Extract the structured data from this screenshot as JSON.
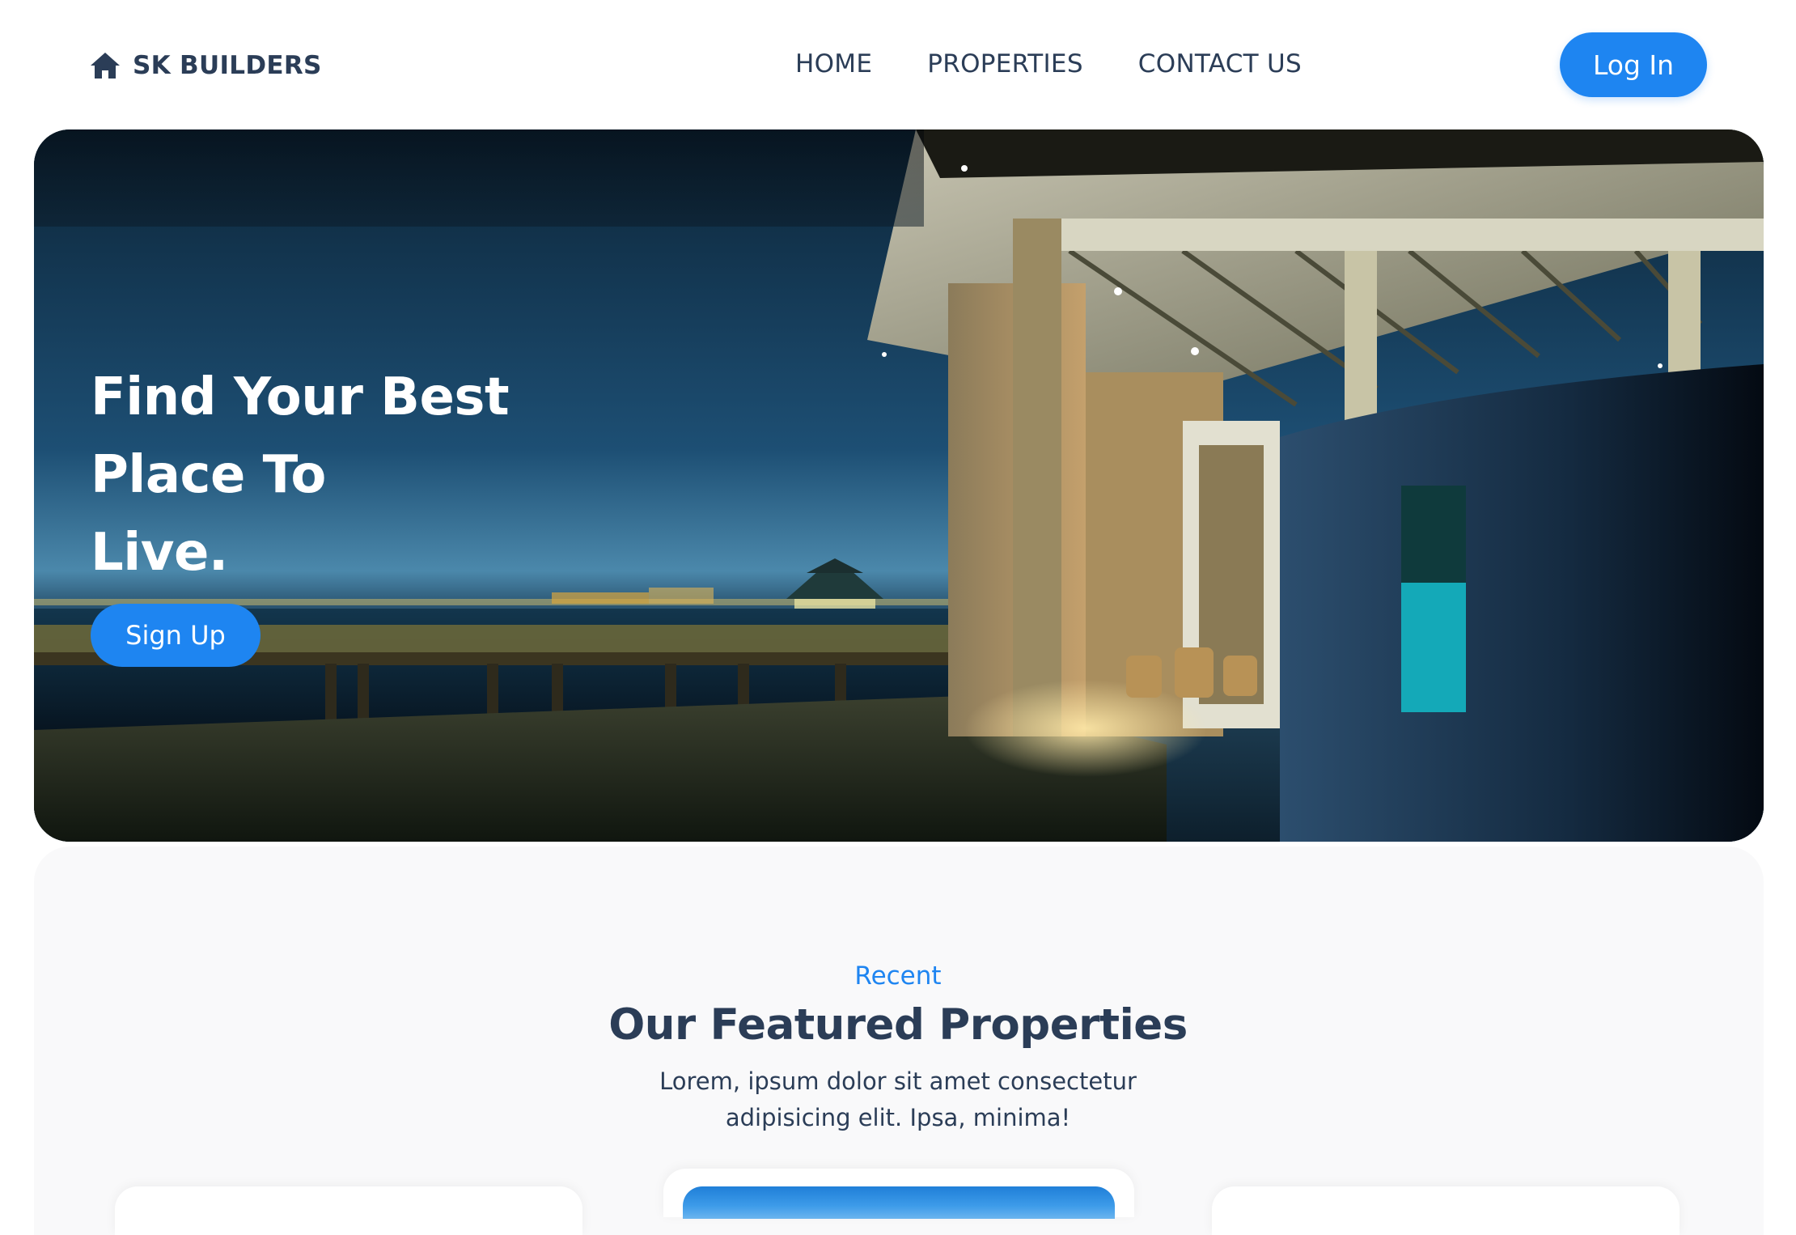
{
  "brand": {
    "name": "SK BUILDERS",
    "icon": "home-icon"
  },
  "nav": {
    "items": [
      "HOME",
      "PROPERTIES",
      "CONTACT US"
    ]
  },
  "header": {
    "login_label": "Log In"
  },
  "hero": {
    "title_lines": [
      "Find Your Best",
      "Place To",
      "Live."
    ],
    "signup_label": "Sign Up"
  },
  "featured": {
    "kicker": "Recent",
    "title": "Our Featured Properties",
    "description": "Lorem, ipsum dolor sit amet consectetur adipisicing elit. Ipsa, minima!"
  },
  "colors": {
    "accent": "#1e85f1",
    "text": "#2b3d57",
    "section_bg": "#f9f9fa"
  }
}
